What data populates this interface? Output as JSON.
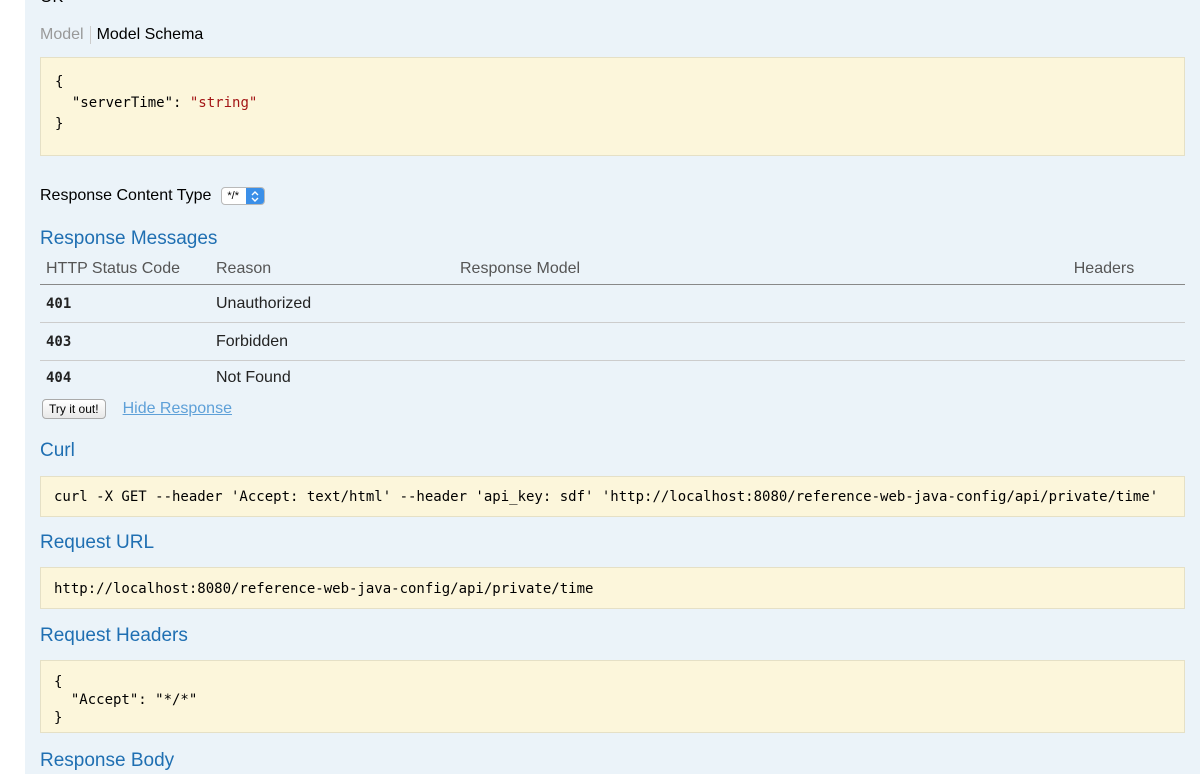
{
  "status_text": "OK",
  "model_tabs": {
    "model": "Model",
    "schema": "Model Schema"
  },
  "schema": {
    "open": "{",
    "key": "\"serverTime\"",
    "colon": ": ",
    "value": "\"string\"",
    "close": "}"
  },
  "response_content_type": {
    "label": "Response Content Type",
    "selected": "*/*"
  },
  "response_messages": {
    "title": "Response Messages",
    "headers": [
      "HTTP Status Code",
      "Reason",
      "Response Model",
      "Headers"
    ],
    "rows": [
      {
        "code": "401",
        "reason": "Unauthorized"
      },
      {
        "code": "403",
        "reason": "Forbidden"
      },
      {
        "code": "404",
        "reason": "Not Found"
      }
    ]
  },
  "actions": {
    "try_label": "Try it out!",
    "hide_label": "Hide Response"
  },
  "curl": {
    "title": "Curl",
    "command": "curl -X GET --header 'Accept: text/html' --header 'api_key: sdf' 'http://localhost:8080/reference-web-java-config/api/private/time'"
  },
  "request_url": {
    "title": "Request URL",
    "value": "http://localhost:8080/reference-web-java-config/api/private/time"
  },
  "request_headers": {
    "title": "Request Headers",
    "open": "{",
    "line": "  \"Accept\": \"*/*\"",
    "close": "}"
  },
  "response_body": {
    "title": "Response Body"
  },
  "colors": {
    "section_title": "#1f6fb2",
    "code_bg": "#fcf6db",
    "panel_bg": "#ebf3f9",
    "string_value": "#a31515"
  }
}
